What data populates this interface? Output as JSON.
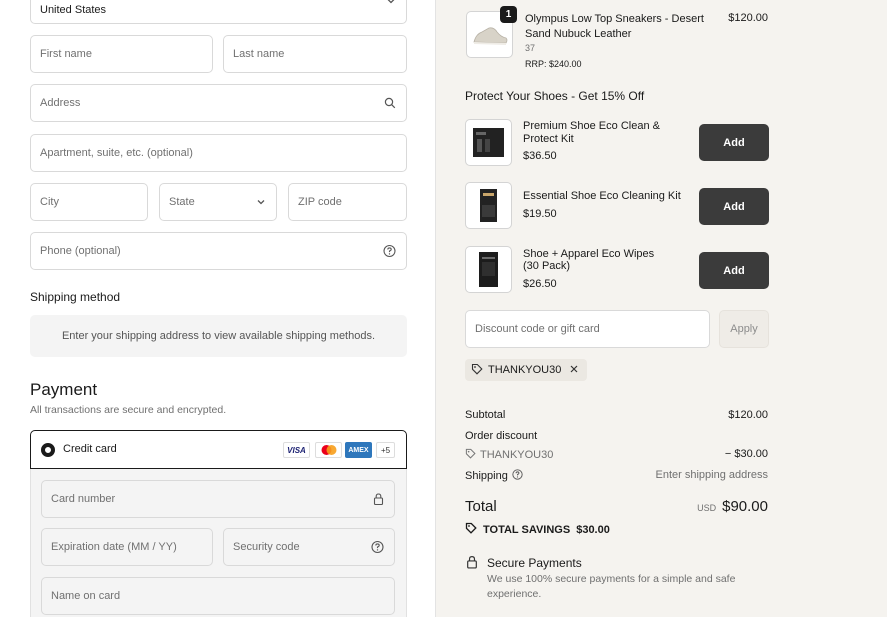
{
  "colors": {
    "accent": "#3b3b3b",
    "panel": "#f5f3ef",
    "border": "#d9d9d9"
  },
  "address": {
    "country_value": "United States",
    "first_name_placeholder": "First name",
    "last_name_placeholder": "Last name",
    "address_placeholder": "Address",
    "apartment_placeholder": "Apartment, suite, etc. (optional)",
    "city_placeholder": "City",
    "state_placeholder": "State",
    "zip_placeholder": "ZIP code",
    "phone_placeholder": "Phone (optional)"
  },
  "shipping": {
    "title": "Shipping method",
    "notice": "Enter your shipping address to view available shipping methods."
  },
  "payment": {
    "title": "Payment",
    "subtitle": "All transactions are secure and encrypted.",
    "method_label": "Credit card",
    "logos": [
      "VISA",
      "MC",
      "AMEX",
      "+5"
    ],
    "card_number_placeholder": "Card number",
    "expiry_placeholder": "Expiration date (MM / YY)",
    "security_placeholder": "Security code",
    "name_placeholder": "Name on card"
  },
  "order": {
    "item": {
      "qty": "1",
      "name": "Olympus Low Top Sneakers - Desert Sand Nubuck Leather",
      "variant": "37",
      "rrp": "RRP: $240.00",
      "price": "$120.00"
    },
    "upsell_title": "Protect Your Shoes - Get 15% Off",
    "upsells": [
      {
        "name": "Premium Shoe Eco Clean & Protect Kit",
        "price": "$36.50",
        "button": "Add"
      },
      {
        "name": "Essential Shoe Eco Cleaning Kit",
        "price": "$19.50",
        "button": "Add"
      },
      {
        "name": "Shoe + Apparel Eco Wipes (30 Pack)",
        "price": "$26.50",
        "button": "Add"
      }
    ],
    "discount_placeholder": "Discount code or gift card",
    "apply_label": "Apply",
    "applied_code": "THANKYOU30",
    "subtotal_label": "Subtotal",
    "subtotal_value": "$120.00",
    "order_discount_label": "Order discount",
    "discount_code": "THANKYOU30",
    "discount_value": "− $30.00",
    "shipping_label": "Shipping",
    "shipping_value": "Enter shipping address",
    "total_label": "Total",
    "total_currency": "USD",
    "total_value": "$90.00",
    "savings_label": "TOTAL SAVINGS",
    "savings_value": "$30.00",
    "secure_title": "Secure Payments",
    "secure_text": "We use 100% secure payments for a simple and safe experience."
  }
}
